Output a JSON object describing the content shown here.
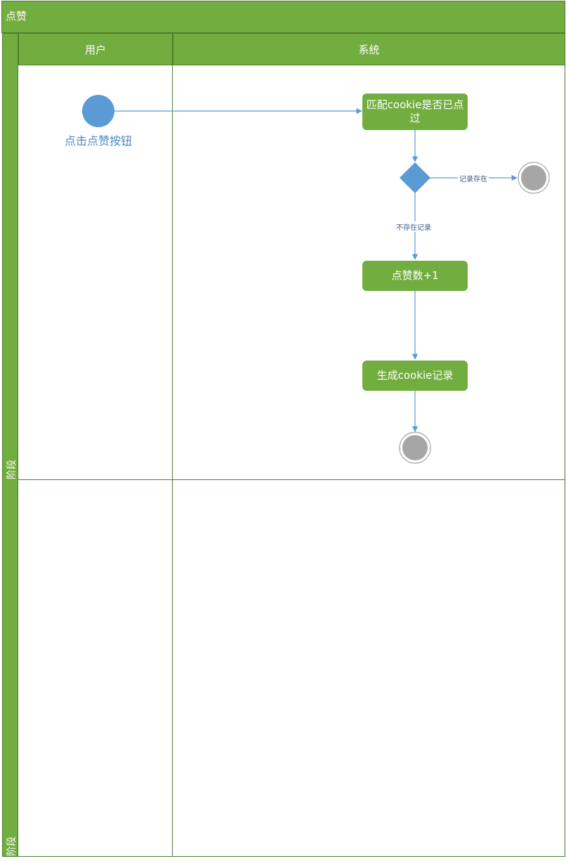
{
  "pool": {
    "title": "点赞"
  },
  "lanes": [
    {
      "label": "用户"
    },
    {
      "label": "系统"
    }
  ],
  "phases": [
    {
      "label": "阶段"
    },
    {
      "label": "阶段"
    }
  ],
  "nodes": {
    "start": {
      "label": "点击点赞按钮"
    },
    "match_cookie": {
      "label": "匹配cookie是否已点过"
    },
    "like_count": {
      "label": "点赞数+1"
    },
    "generate_cookie": {
      "label": "生成cookie记录"
    }
  },
  "edges": {
    "record_exists": {
      "label": "记录存在"
    },
    "no_record": {
      "label": "不存在记录"
    }
  },
  "colors": {
    "lane_fill": "#72ad40",
    "lane_border": "#4e7e2a",
    "start_node": "#5b9bd5",
    "end_node": "#a6a6a6",
    "connector": "#5b9bd5",
    "start_label": "#4a8ac4"
  }
}
